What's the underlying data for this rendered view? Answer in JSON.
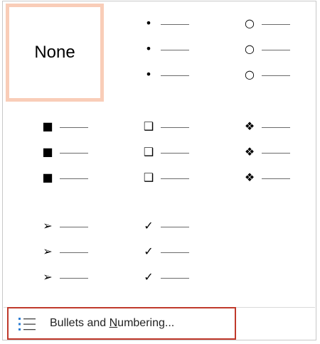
{
  "gallery": {
    "none_label": "None",
    "cells": [
      {
        "name": "none",
        "selected": true
      },
      {
        "name": "filled-round-bullet",
        "glyph": "•",
        "icon": "filled-round-bullet-icon"
      },
      {
        "name": "hollow-round-bullet",
        "glyph": "○",
        "icon": "hollow-round-bullet-icon"
      },
      {
        "name": "filled-square-bullet",
        "glyph": "■",
        "icon": "filled-square-bullet-icon"
      },
      {
        "name": "hollow-square-bullet",
        "glyph": "❑",
        "icon": "hollow-square-bullet-icon"
      },
      {
        "name": "diamond-cluster-bullet",
        "glyph": "❖",
        "icon": "diamond-cluster-bullet-icon"
      },
      {
        "name": "arrowhead-bullet",
        "glyph": "➢",
        "icon": "arrowhead-bullet-icon"
      },
      {
        "name": "checkmark-bullet",
        "glyph": "✓",
        "icon": "checkmark-bullet-icon"
      }
    ]
  },
  "footer": {
    "label_before": "Bullets and ",
    "label_accel": "N",
    "label_after": "umbering...",
    "icon": "bullet-list-icon",
    "icon_color": "#2b7cd3",
    "border_color": "#c0392b"
  },
  "colors": {
    "selected_border": "#f9cdb8"
  }
}
